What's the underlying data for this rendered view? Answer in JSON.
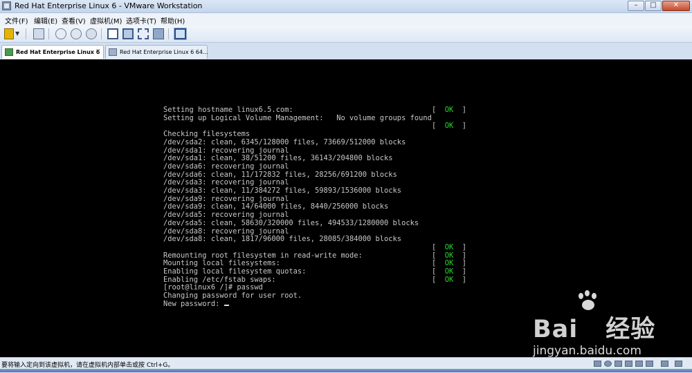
{
  "window": {
    "title": "Red Hat Enterprise Linux 6 - VMware Workstation",
    "icon": "vmware-app-icon",
    "controls": [
      "minimize-icon",
      "maximize-icon",
      "close-icon"
    ]
  },
  "menu": [
    "文件(F)",
    "编辑(E)",
    "查看(V)",
    "虚拟机(M)",
    "选项卡(T)",
    "帮助(H)"
  ],
  "toolbar": {
    "icons": [
      "power-pause-icon",
      "dropdown-icon",
      "network-icon",
      "snapshot-take-icon",
      "snapshot-revert-icon",
      "snapshot-manager-icon",
      "console-view-icon",
      "full-screen-icon",
      "fit-window-icon",
      "unity-icon",
      "thumbnail-bar-icon"
    ]
  },
  "tabs": [
    {
      "label": "Red Hat Enterprise Linux 6",
      "active": true
    },
    {
      "label": "Red Hat Enterprise Linux 6 64...",
      "active": false
    }
  ],
  "console": {
    "lines": [
      "Setting hostname linux6.5.com:",
      "Setting up Logical Volume Management:   No volume groups found",
      "",
      "Checking filesystems",
      "/dev/sda2: clean, 6345/128000 files, 73669/512000 blocks",
      "/dev/sda1: recovering journal",
      "/dev/sda1: clean, 38/51200 files, 36143/204800 blocks",
      "/dev/sda6: recovering journal",
      "/dev/sda6: clean, 11/172832 files, 28256/691200 blocks",
      "/dev/sda3: recovering journal",
      "/dev/sda3: clean, 11/384272 files, 59893/1536000 blocks",
      "/dev/sda9: recovering journal",
      "/dev/sda9: clean, 14/64000 files, 8440/256000 blocks",
      "/dev/sda5: recovering journal",
      "/dev/sda5: clean, 58630/320000 files, 494533/1280000 blocks",
      "/dev/sda8: recovering journal",
      "/dev/sda8: clean, 1817/96000 files, 28085/384000 blocks",
      "",
      "Remounting root filesystem in read-write mode:",
      "Mounting local filesystems:",
      "Enabling local filesystem quotas:",
      "Enabling /etc/fstab swaps:",
      "[root@linux6 /]# passwd",
      "Changing password for user root.",
      "New password: "
    ],
    "ok_rows": [
      0,
      2,
      17,
      18,
      19,
      20,
      21
    ],
    "ok_label": "OK",
    "ok_color": "#2fd42f",
    "background": "#000000",
    "text_color": "#c8c8c8"
  },
  "watermark": {
    "text": "Bai",
    "text2": "经验",
    "sub": "jingyan.baidu.com"
  },
  "status": {
    "text": "要将输入定向到该虚拟机，请在虚拟机内部单击或按 Ctrl+G。",
    "icons": [
      "hdd-icon",
      "cdrom-icon",
      "network-adapter-icon",
      "usb-icon",
      "sound-icon",
      "printer-icon",
      "display-icon",
      "message-icon"
    ]
  }
}
